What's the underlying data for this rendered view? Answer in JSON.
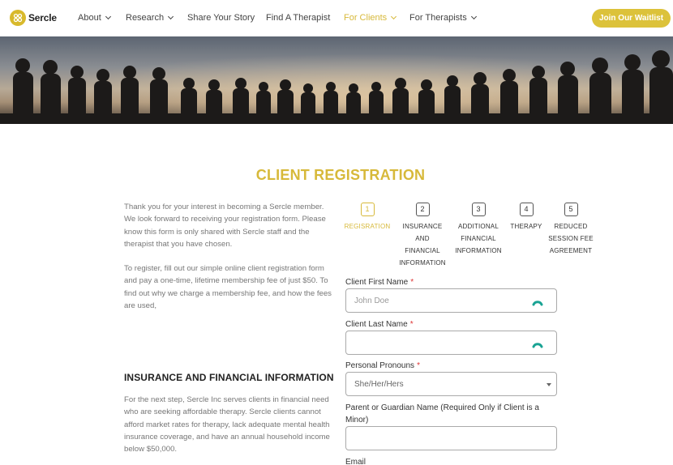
{
  "nav": {
    "logo_text": "Sercle",
    "items": [
      {
        "label": "About",
        "dropdown": true
      },
      {
        "label": "Research",
        "dropdown": true
      },
      {
        "label": "Share Your Story",
        "dropdown": false
      },
      {
        "label": "Find A Therapist",
        "dropdown": false
      },
      {
        "label": "For Clients",
        "dropdown": true,
        "active": true
      },
      {
        "label": "For Therapists",
        "dropdown": true
      }
    ],
    "cta_label": "Join Our Waitlist"
  },
  "colors": {
    "accent": "#d7b93a",
    "required": "#d33333"
  },
  "page": {
    "title": "CLIENT REGISTRATION",
    "intro_paragraph": "Thank you for your interest in becoming a Sercle member. We look forward to receiving your registration form. Please know this form is only shared with Sercle staff and the therapist that you have chosen.",
    "register_paragraph": "To register, fill out our simple online client registration form and pay a one-time, lifetime membership fee of just $50. To find out why we charge a membership fee, and how the fees are used,",
    "section_heading": "INSURANCE AND FINANCIAL INFORMATION",
    "section_paragraph": "For the next step, Sercle Inc serves clients in financial need who are seeking affordable therapy. Sercle clients cannot afford market rates for therapy, lack adequate mental health insurance coverage, and have an annual household income below $50,000."
  },
  "steps": [
    {
      "number": "1",
      "label": "REGISRATION",
      "active": true
    },
    {
      "number": "2",
      "label": "INSURANCE AND FINANCIAL INFORMATION"
    },
    {
      "number": "3",
      "label": "ADDITIONAL FINANCIAL INFORMATION"
    },
    {
      "number": "4",
      "label": "THERAPY"
    },
    {
      "number": "5",
      "label": "REDUCED SESSION FEE AGREEMENT"
    }
  ],
  "form": {
    "first_name": {
      "label": "Client First Name",
      "required_mark": "*",
      "placeholder": "John Doe",
      "value": ""
    },
    "last_name": {
      "label": "Client Last Name",
      "required_mark": "*",
      "value": ""
    },
    "pronouns": {
      "label": "Personal Pronouns",
      "required_mark": "*",
      "selected": "She/Her/Hers"
    },
    "guardian": {
      "label": "Parent or Guardian Name (Required Only if Client is a Minor)",
      "value": ""
    },
    "email": {
      "label": "Email"
    }
  },
  "icons": {
    "logo": "sercle-logo-icon",
    "field_helper": "autofill-spinner-icon",
    "select_caret": "caret-down-icon"
  }
}
